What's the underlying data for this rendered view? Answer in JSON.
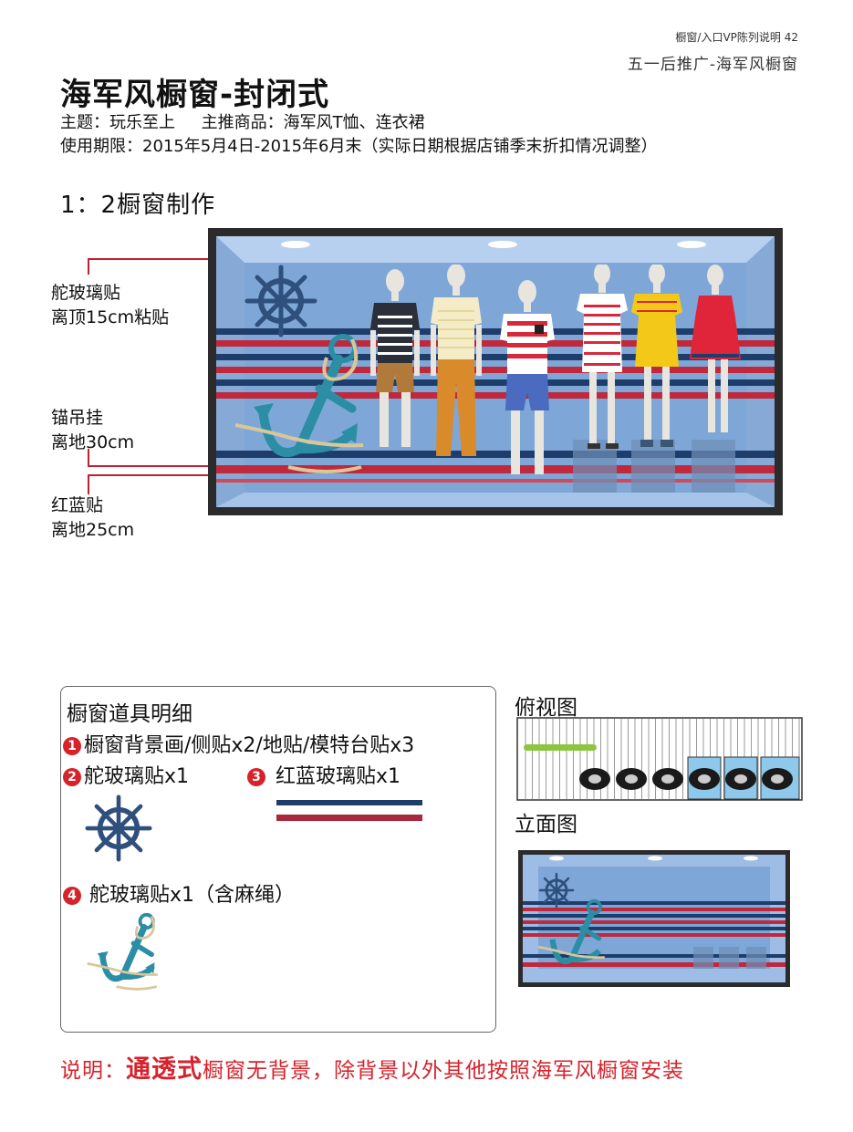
{
  "header": {
    "ref": "橱窗/入口VP陈列说明 42",
    "sub": "五一后推广-海军风橱窗"
  },
  "title": "海军风橱窗-封闭式",
  "info": {
    "line1": "主题：玩乐至上     主推商品：海军风T恤、连衣裙",
    "line2": "使用期限：2015年5月4日-2015年6月末（实际日期根据店铺季末折扣情况调整）"
  },
  "section_title": "1：2橱窗制作",
  "callouts": [
    {
      "line1": "舵玻璃贴",
      "line2": "离顶15cm粘贴"
    },
    {
      "line1": "锚吊挂",
      "line2": "离地30cm"
    },
    {
      "line1": "红蓝贴",
      "line2": "离地25cm"
    }
  ],
  "props": {
    "title": "橱窗道具明细",
    "items": [
      {
        "num": "1",
        "text": "橱窗背景画/侧贴x2/地贴/模特台贴x3"
      },
      {
        "num": "2",
        "text": "舵玻璃贴x1"
      },
      {
        "num": "3",
        "text": "红蓝玻璃贴x1"
      },
      {
        "num": "4",
        "text": "舵玻璃贴x1（含麻绳）"
      }
    ]
  },
  "views": {
    "top_view": "俯视图",
    "elevation": "立面图"
  },
  "note": {
    "prefix": "说明：",
    "emphasis": "通透式",
    "rest": "橱窗无背景，除背景以外其他按照海军风橱窗安装"
  },
  "colors": {
    "accent_red": "#d6222b",
    "stripe_red": "#c0283c",
    "stripe_navy": "#1f3d6b",
    "window_blue": "#7ea7d8",
    "anchor_teal": "#2c8ea5"
  },
  "icons": [
    "ship-wheel-icon",
    "anchor-icon",
    "mannequin-icon"
  ]
}
